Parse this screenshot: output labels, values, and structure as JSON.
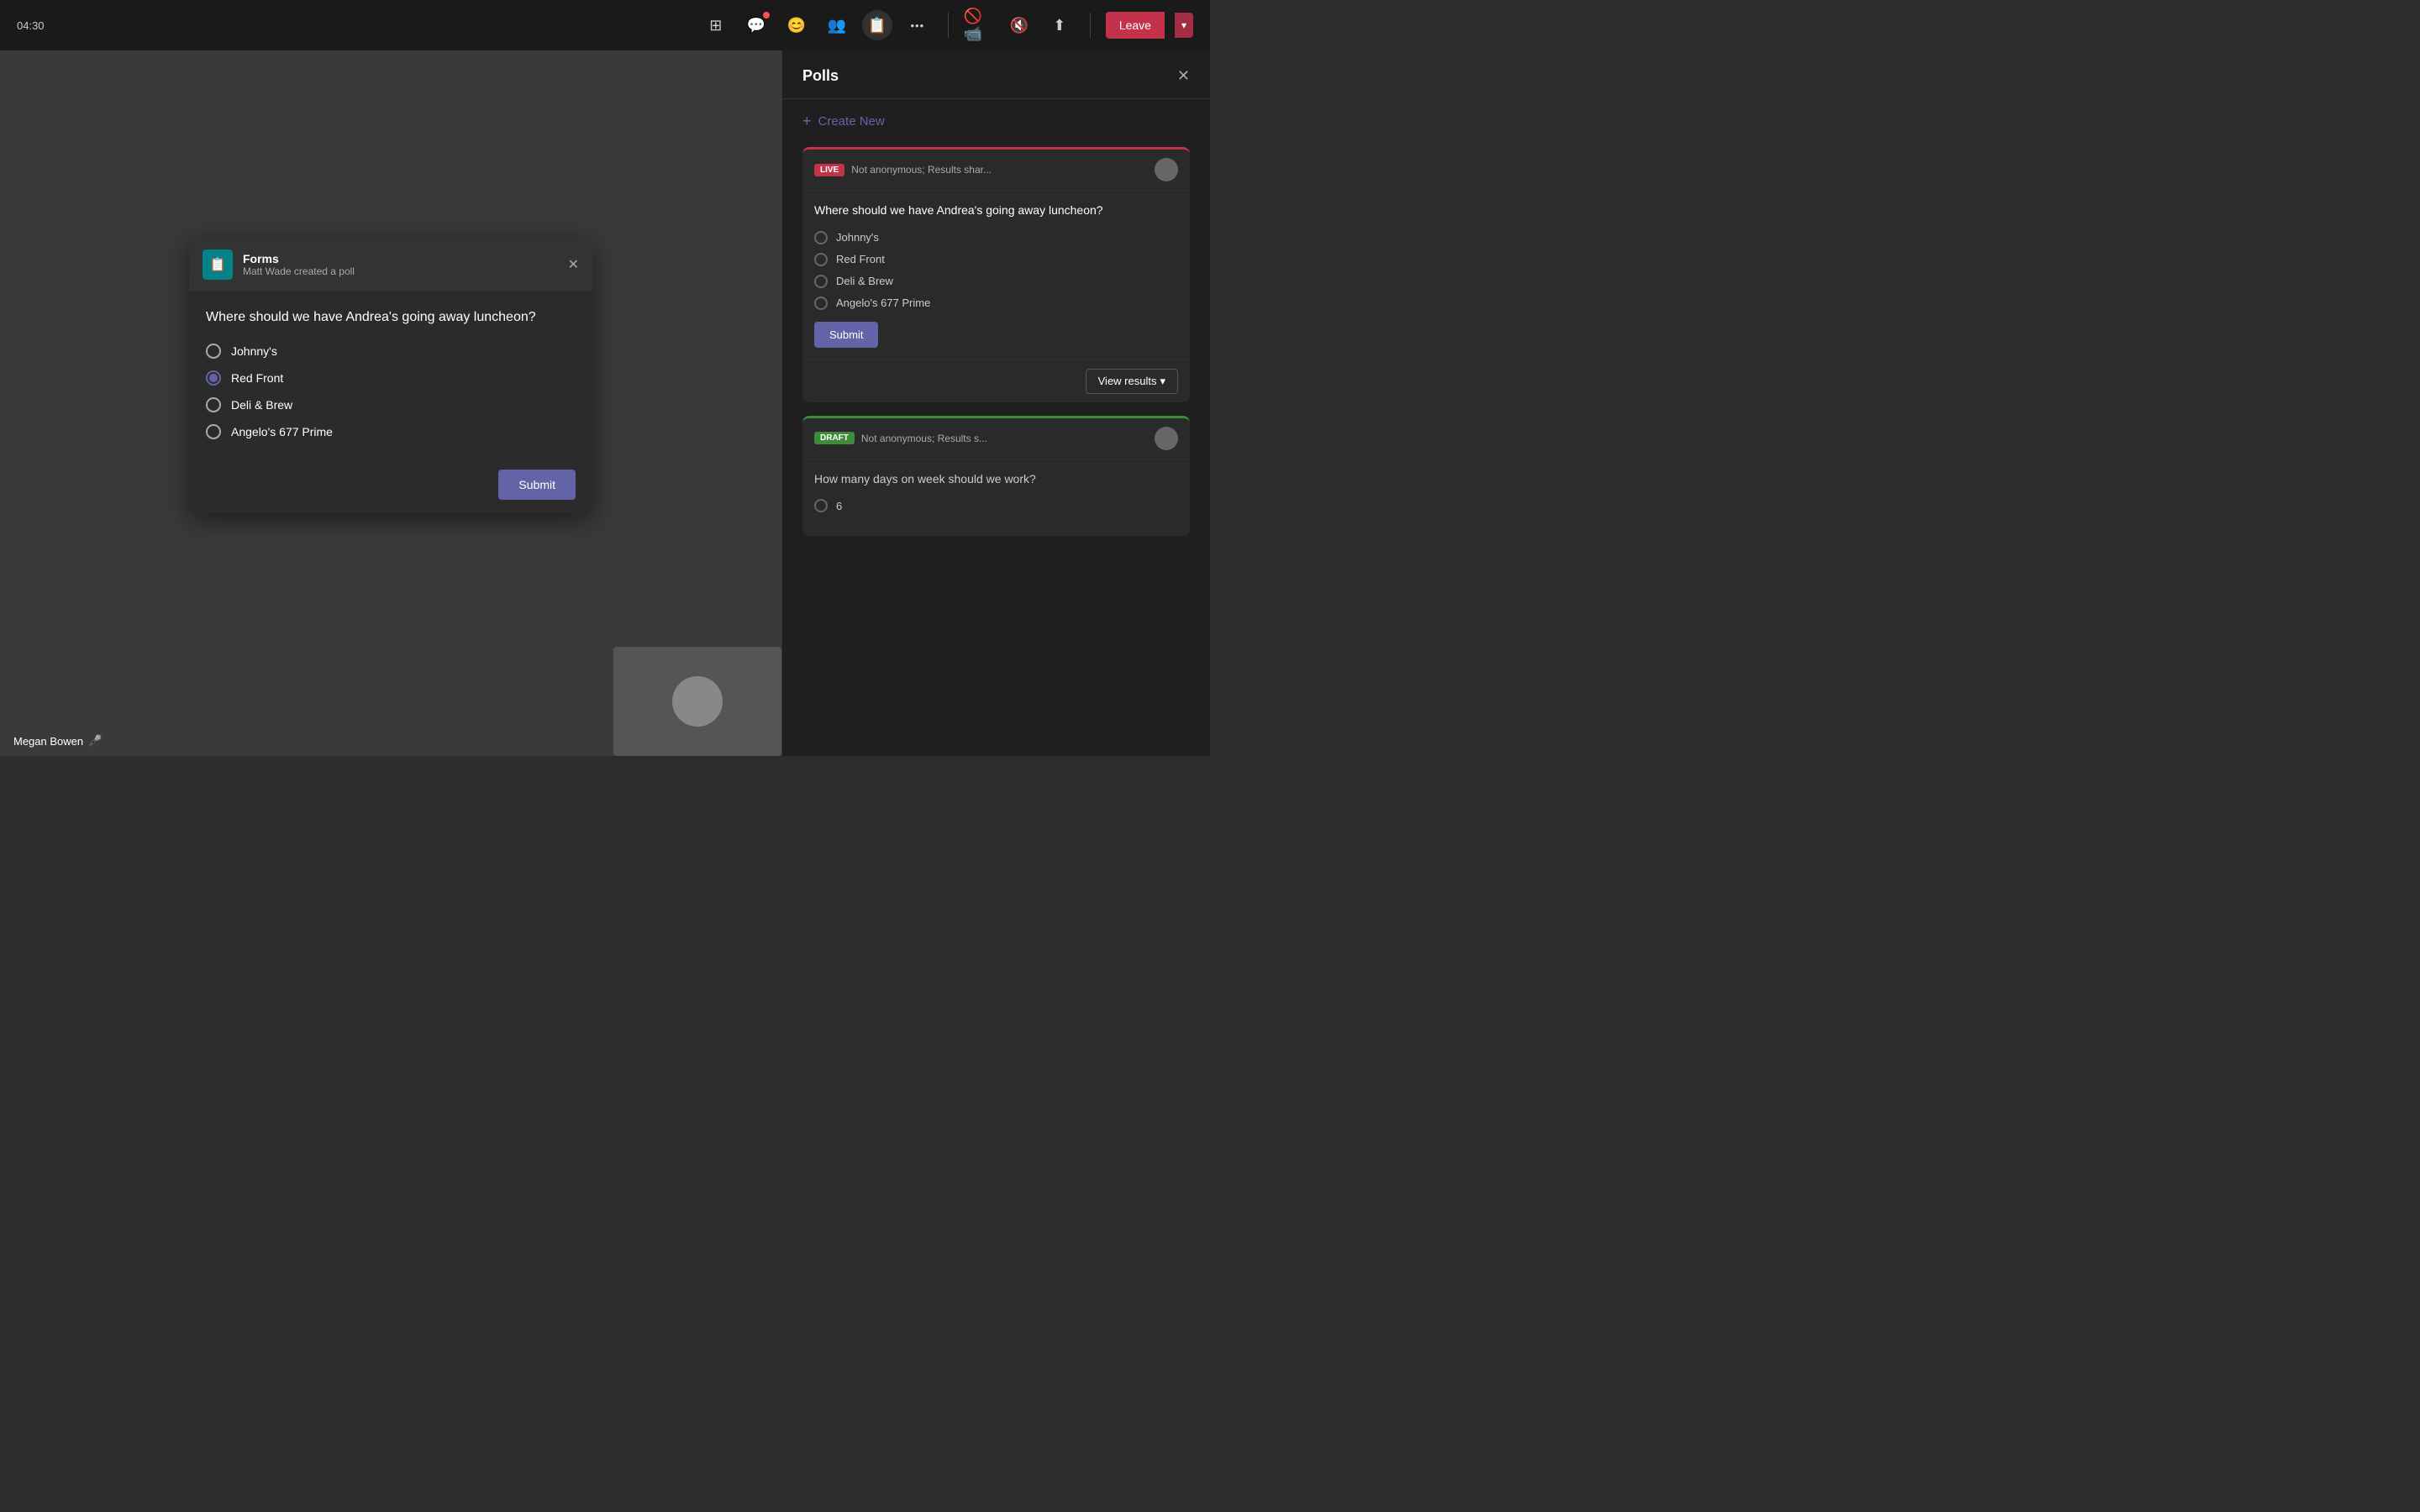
{
  "topbar": {
    "time": "04:30",
    "icons": [
      {
        "name": "apps-icon",
        "symbol": "⊞",
        "badge": false
      },
      {
        "name": "chat-icon",
        "symbol": "💬",
        "badge": true
      },
      {
        "name": "reactions-icon",
        "symbol": "😊",
        "badge": false
      },
      {
        "name": "people-icon",
        "symbol": "👥",
        "badge": false
      },
      {
        "name": "forms-icon",
        "symbol": "📋",
        "badge": false,
        "active": true
      },
      {
        "name": "more-icon",
        "symbol": "•••",
        "badge": false
      }
    ],
    "media_icons": [
      {
        "name": "video-off-icon",
        "symbol": "📷",
        "muted": true
      },
      {
        "name": "mic-off-icon",
        "symbol": "🎤",
        "muted": true
      },
      {
        "name": "share-icon",
        "symbol": "↑",
        "muted": false
      }
    ],
    "leave_label": "Leave"
  },
  "poll_popup": {
    "forms_label": "Forms",
    "subtitle": "Matt Wade created a poll",
    "question": "Where should we have Andrea's going away luncheon?",
    "options": [
      {
        "label": "Johnny's",
        "selected": false
      },
      {
        "label": "Red Front",
        "selected": true
      },
      {
        "label": "Deli & Brew",
        "selected": false
      },
      {
        "label": "Angelo's 677 Prime",
        "selected": false
      }
    ],
    "submit_label": "Submit"
  },
  "right_panel": {
    "title": "Polls",
    "create_new_label": "Create New",
    "live_poll": {
      "badge": "LIVE",
      "meta": "Not anonymous; Results shar...",
      "question": "Where should we have Andrea's going away luncheon?",
      "options": [
        {
          "label": "Johnny's"
        },
        {
          "label": "Red Front"
        },
        {
          "label": "Deli & Brew"
        },
        {
          "label": "Angelo's 677 Prime"
        }
      ],
      "submit_label": "Submit",
      "view_results_label": "View results"
    },
    "draft_poll": {
      "badge": "DRAFT",
      "meta": "Not anonymous; Results s...",
      "question": "How many days on week should we work?",
      "options": [
        {
          "label": "6"
        }
      ]
    }
  },
  "user": {
    "name": "Megan Bowen"
  }
}
